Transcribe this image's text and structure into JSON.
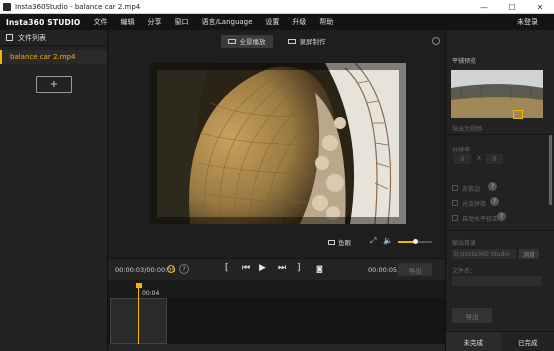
{
  "window": {
    "title": "Insta360Studio - balance car 2.mp4",
    "controls": [
      "—",
      "☐",
      "✕"
    ]
  },
  "menubar": {
    "logo": "Insta360 STUDIO",
    "items": [
      "文件",
      "编辑",
      "分享",
      "窗口",
      "语言/Language",
      "设置",
      "升级",
      "帮助"
    ],
    "login": "未登录"
  },
  "left_panel": {
    "header": "文件列表",
    "files": [
      "balance car 2.mp4"
    ],
    "add_label": "+"
  },
  "center": {
    "modes": [
      "全景播放",
      "录屏制作"
    ],
    "active_mode": 0,
    "vr_label": "鱼眼",
    "volume": 0.5
  },
  "playback": {
    "current_time": "00:00:03/00:00:05",
    "end_time": "00:00:05",
    "help": "?",
    "export_label": "导出"
  },
  "timeline": {
    "marker": "00:04"
  },
  "right_panel": {
    "thumbnail_title": "平铺预览",
    "export_as_image": "导出为视频",
    "resolution_label": "分辨率",
    "res_w": "0",
    "res_x": "X",
    "res_h": "0",
    "options": [
      {
        "label": "去紫边",
        "help": "?"
      },
      {
        "label": "光流拼接",
        "help": "?"
      },
      {
        "label": "自动水平校正",
        "help": "?"
      }
    ],
    "output_dir_label": "输出目录",
    "output_dir_value": "D:\\Insta360 Studio",
    "browse_label": "浏览",
    "filename_label": "文件名：",
    "export_button": "导出",
    "tabs": [
      "未完成",
      "已完成"
    ]
  },
  "colors": {
    "accent": "#f4b400",
    "background": "#1b1b1b",
    "panel": "#222222"
  }
}
